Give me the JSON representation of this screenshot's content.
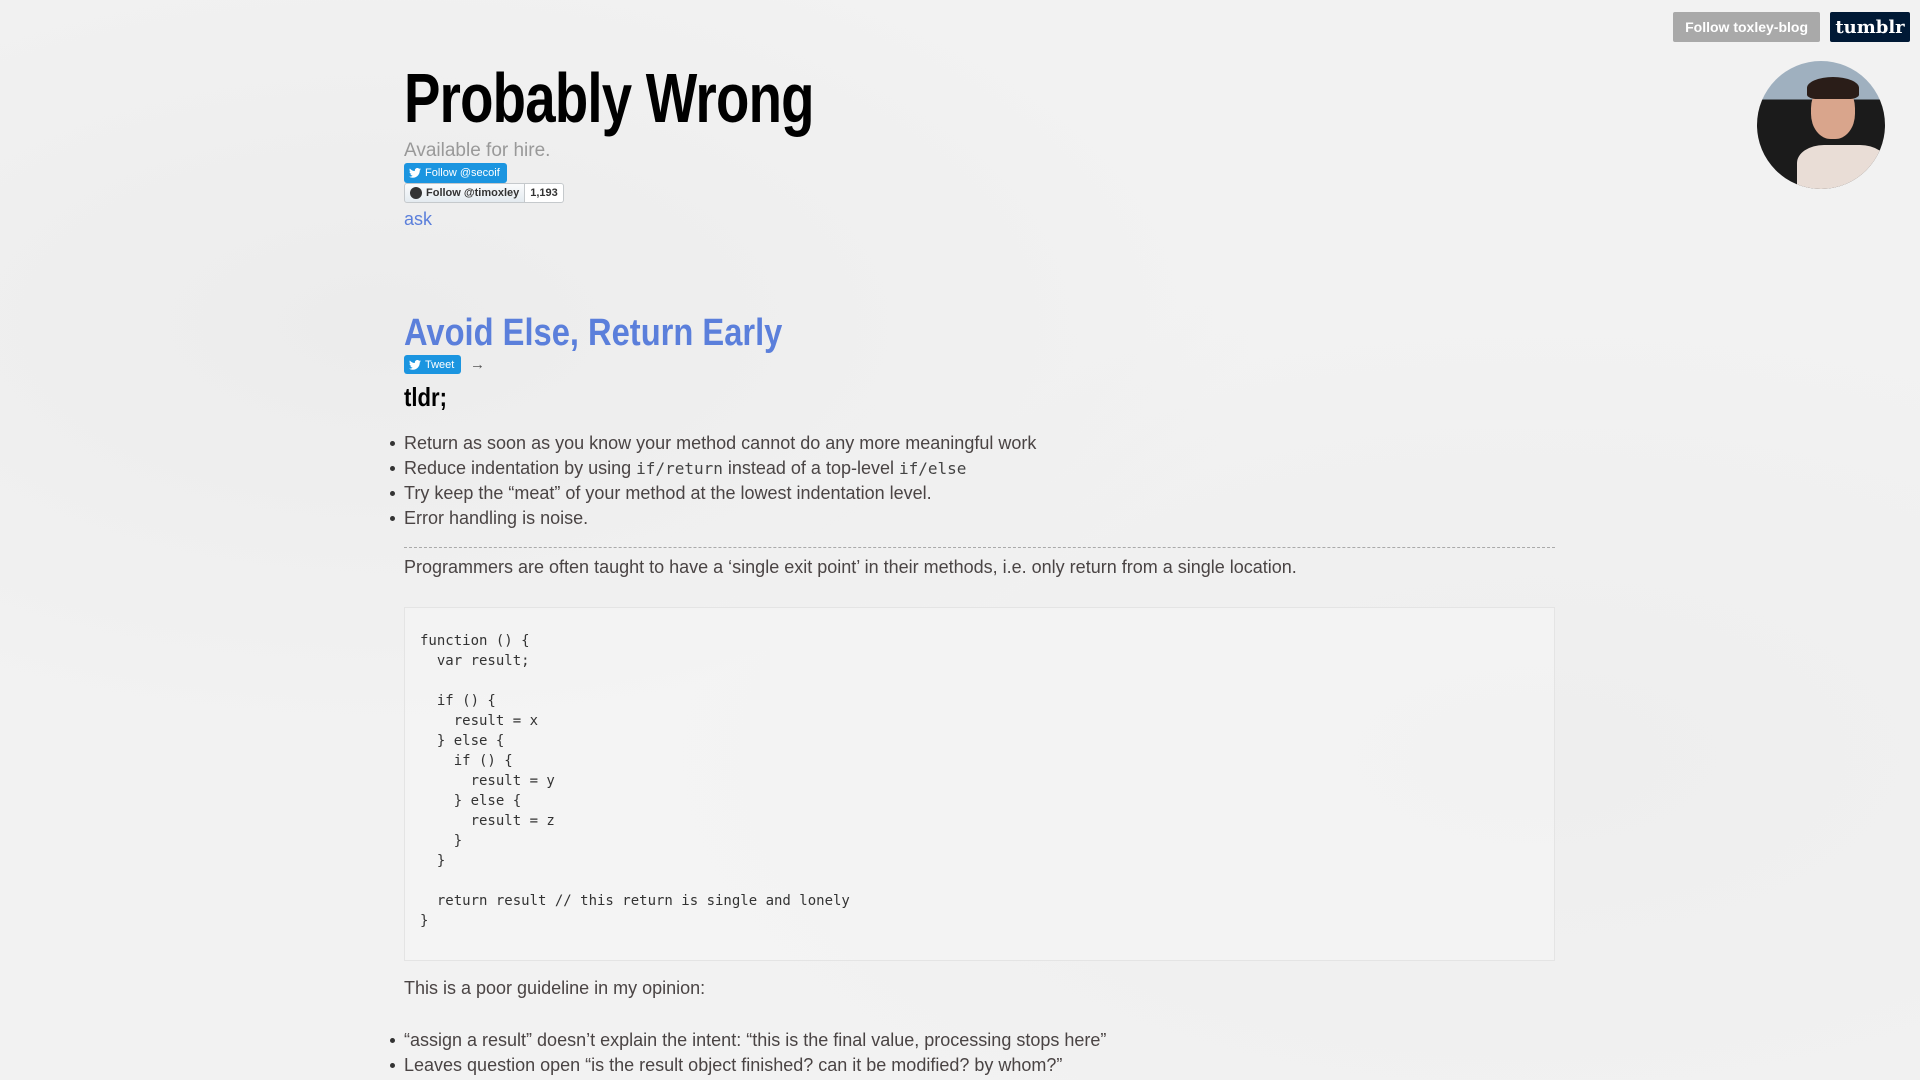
{
  "topbar": {
    "follow_label": "Follow toxley-blog",
    "tumblr_logo": "tumblr"
  },
  "blog": {
    "title": "Probably Wrong",
    "description": "Available for hire.",
    "twitter_follow": "Follow @secoif",
    "github_follow": "Follow @timoxley",
    "github_count": "1,193",
    "ask": "ask"
  },
  "post": {
    "title": "Avoid Else, Return Early",
    "tweet_label": "Tweet",
    "arrow": "→",
    "tldr": "tldr;",
    "tldr_items": [
      {
        "text": "Return as soon as you know your method cannot do any more meaningful work"
      },
      {
        "pre": "Reduce indentation by using ",
        "code1": "if/return",
        "mid": " instead of a top-level ",
        "code2": "if/else"
      },
      {
        "text": "Try keep the “meat” of your method at the lowest indentation level."
      },
      {
        "text": "Error handling is noise."
      }
    ],
    "intro": "Programmers are often taught to have a ‘single exit point’ in their methods, i.e. only return from a single location.",
    "code": "function () {\n  var result;\n\n  if () {\n    result = x\n  } else {\n    if () {\n      result = y\n    } else {\n      result = z\n    }\n  }\n\n  return result // this return is single and lonely\n}",
    "opinion": "This is a poor guideline in my opinion:",
    "opinion_items": [
      "“assign a result” doesn’t explain the intent: “this is the final value, processing stops here”",
      "Leaves question open “is the result object finished? can it be modified? by whom?”"
    ]
  },
  "colors": {
    "link": "#5b7fdb",
    "twitter": "#1b95e0",
    "tumblr": "#001935"
  }
}
